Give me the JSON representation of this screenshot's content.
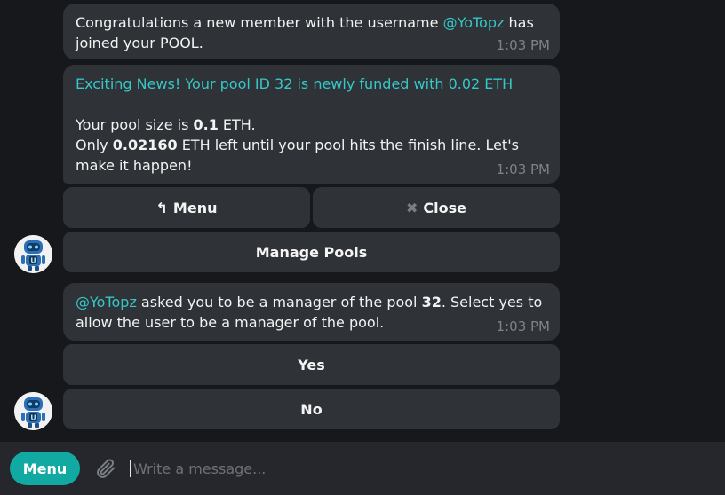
{
  "messages": [
    {
      "mention": "@YoTopz",
      "text_before": "Congratulations a new member with the username ",
      "text_after": " has joined your POOL.",
      "time": "1:03 PM"
    },
    {
      "headline": "Exciting News! Your pool ID 32 is newly funded with 0.02 ETH",
      "size_prefix": "Your pool size is ",
      "size_value": "0.1",
      "size_suffix": " ETH.",
      "left_prefix": "Only ",
      "left_value": "0.02160",
      "left_suffix": " ETH left until your pool hits the finish line. Let's make it happen!",
      "time": "1:03 PM"
    },
    {
      "mention": "@YoTopz",
      "text_before": " asked you to be a manager of the pool ",
      "pool_id": "32",
      "text_after": ". Select yes to allow the user to be a manager of the pool.",
      "time": "1:03 PM"
    }
  ],
  "keyboard1": {
    "menu_icon": "↰",
    "menu_label": "Menu",
    "close_icon": "✖",
    "close_label": "Close",
    "manage_label": "Manage Pools"
  },
  "keyboard2": {
    "yes_label": "Yes",
    "no_label": "No"
  },
  "composer": {
    "menu_label": "Menu",
    "placeholder": "Write a message..."
  },
  "colors": {
    "accent": "#36c8c8",
    "menu_button": "#12a9a3",
    "bubble": "#2f3237",
    "background": "#17181c"
  },
  "icons": {
    "avatar": "robot-avatar-icon",
    "attach": "paperclip-icon"
  }
}
